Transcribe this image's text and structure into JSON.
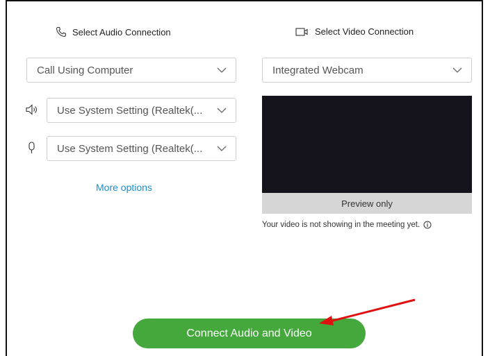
{
  "audio": {
    "heading": "Select Audio Connection",
    "connection_value": "Call Using Computer",
    "speaker_value": "Use System Setting (Realtek(...",
    "microphone_value": "Use System Setting (Realtek(...",
    "more_options": "More options"
  },
  "video": {
    "heading": "Select Video Connection",
    "camera_value": "Integrated Webcam",
    "preview_label": "Preview only",
    "note": "Your video is not showing in the meeting yet."
  },
  "actions": {
    "connect_label": "Connect Audio and Video"
  },
  "colors": {
    "connect_button": "#44a83c",
    "link": "#1a8fd1",
    "annotation_arrow": "#e01010",
    "preview_background": "#14121a"
  },
  "icons": {
    "audio_heading": "phone-icon",
    "video_heading": "video-camera-icon",
    "speaker": "speaker-icon",
    "microphone": "microphone-icon",
    "info": "info-icon",
    "dropdown": "chevron-down-icon"
  }
}
